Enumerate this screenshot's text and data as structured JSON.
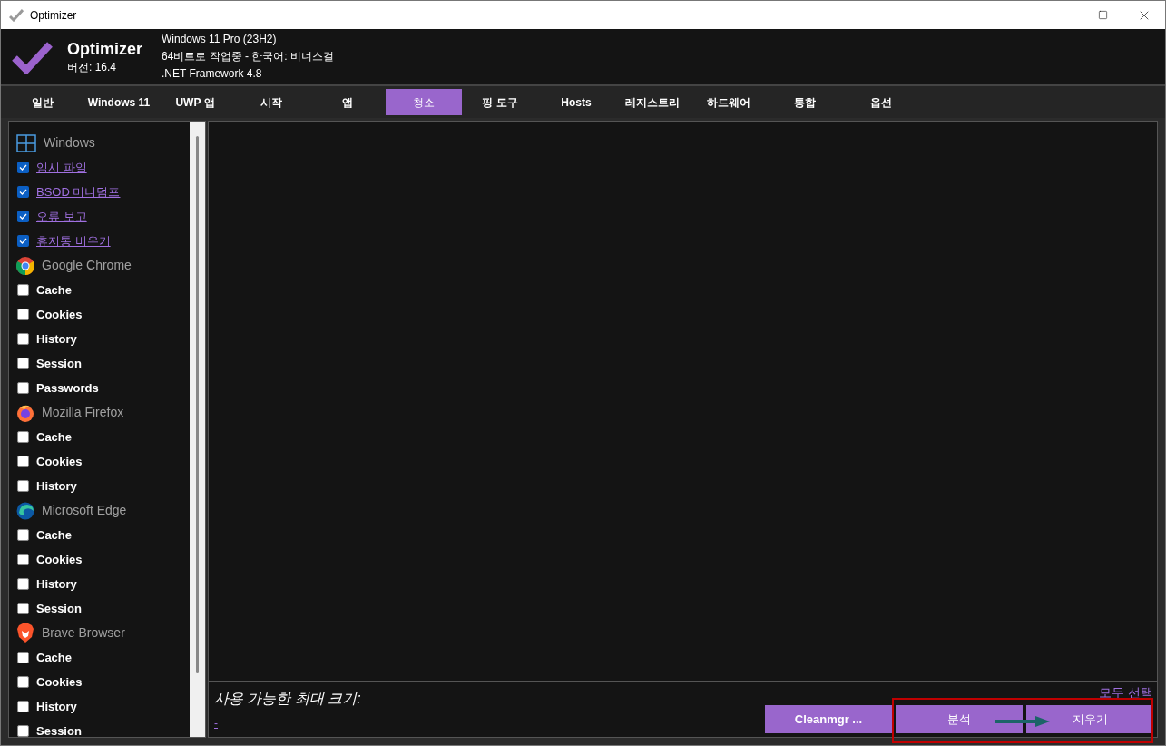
{
  "window": {
    "title": "Optimizer"
  },
  "header": {
    "app_name": "Optimizer",
    "version": "버전: 16.4",
    "info": [
      "Windows 11 Pro (23H2)",
      "64비트로 작업중 - 한국어: 비너스걸",
      ".NET Framework 4.8"
    ]
  },
  "tabs": [
    {
      "label": "일반",
      "selected": false
    },
    {
      "label": "Windows 11",
      "selected": false
    },
    {
      "label": "UWP 앱",
      "selected": false
    },
    {
      "label": "시작",
      "selected": false
    },
    {
      "label": "앱",
      "selected": false
    },
    {
      "label": "청소",
      "selected": true
    },
    {
      "label": "핑 도구",
      "selected": false
    },
    {
      "label": "Hosts",
      "selected": false
    },
    {
      "label": "레지스트리",
      "selected": false
    },
    {
      "label": "하드웨어",
      "selected": false
    },
    {
      "label": "통합",
      "selected": false
    },
    {
      "label": "옵션",
      "selected": false
    }
  ],
  "groups": [
    {
      "kind": "windows",
      "name": "Windows",
      "items": [
        {
          "label": "임시 파일",
          "checked": true
        },
        {
          "label": "BSOD 미니덤프",
          "checked": true
        },
        {
          "label": "오류 보고",
          "checked": true
        },
        {
          "label": "휴지통 비우기",
          "checked": true
        }
      ]
    },
    {
      "kind": "chrome",
      "name": "Google Chrome",
      "items": [
        {
          "label": "Cache",
          "checked": false
        },
        {
          "label": "Cookies",
          "checked": false
        },
        {
          "label": "History",
          "checked": false
        },
        {
          "label": "Session",
          "checked": false
        },
        {
          "label": "Passwords",
          "checked": false
        }
      ]
    },
    {
      "kind": "firefox",
      "name": "Mozilla Firefox",
      "items": [
        {
          "label": "Cache",
          "checked": false
        },
        {
          "label": "Cookies",
          "checked": false
        },
        {
          "label": "History",
          "checked": false
        }
      ]
    },
    {
      "kind": "edge",
      "name": "Microsoft Edge",
      "items": [
        {
          "label": "Cache",
          "checked": false
        },
        {
          "label": "Cookies",
          "checked": false
        },
        {
          "label": "History",
          "checked": false
        },
        {
          "label": "Session",
          "checked": false
        }
      ]
    },
    {
      "kind": "brave",
      "name": "Brave Browser",
      "items": [
        {
          "label": "Cache",
          "checked": false
        },
        {
          "label": "Cookies",
          "checked": false
        },
        {
          "label": "History",
          "checked": false
        },
        {
          "label": "Session",
          "checked": false
        }
      ]
    }
  ],
  "bottom": {
    "size_label": "사용 가능한 최대 크기:",
    "size_value": "-",
    "select_all": "모두 선택",
    "buttons": [
      "Cleanmgr ...",
      "분석",
      "지우기"
    ]
  }
}
